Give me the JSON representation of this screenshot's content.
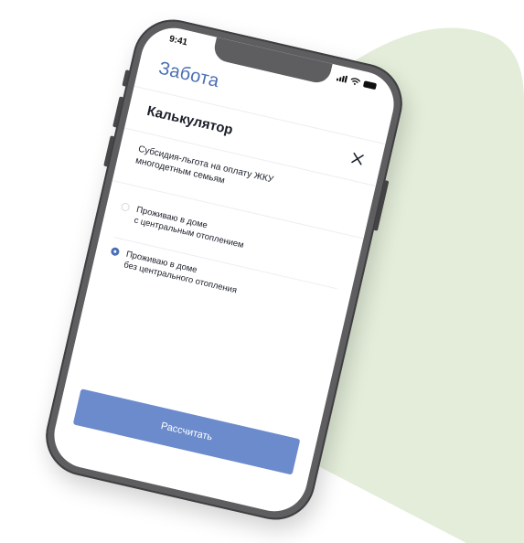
{
  "status_bar": {
    "time": "9:41"
  },
  "app": {
    "logo": "Забота",
    "accent_color": "#4a6fb5"
  },
  "dialog": {
    "title": "Калькулятор",
    "close_icon": "close-icon",
    "subtitle": "Субсидия-льгота на оплату ЖКУ многодетным семьям",
    "options": [
      {
        "label": "Проживаю в доме\nс центральным отоплением",
        "selected": false
      },
      {
        "label": "Проживаю в доме\nбез центрального отопления",
        "selected": true
      }
    ],
    "submit_label": "Рассчитать",
    "button_color": "#6b8bcc"
  },
  "background": {
    "shape_color": "#e3edd9"
  }
}
